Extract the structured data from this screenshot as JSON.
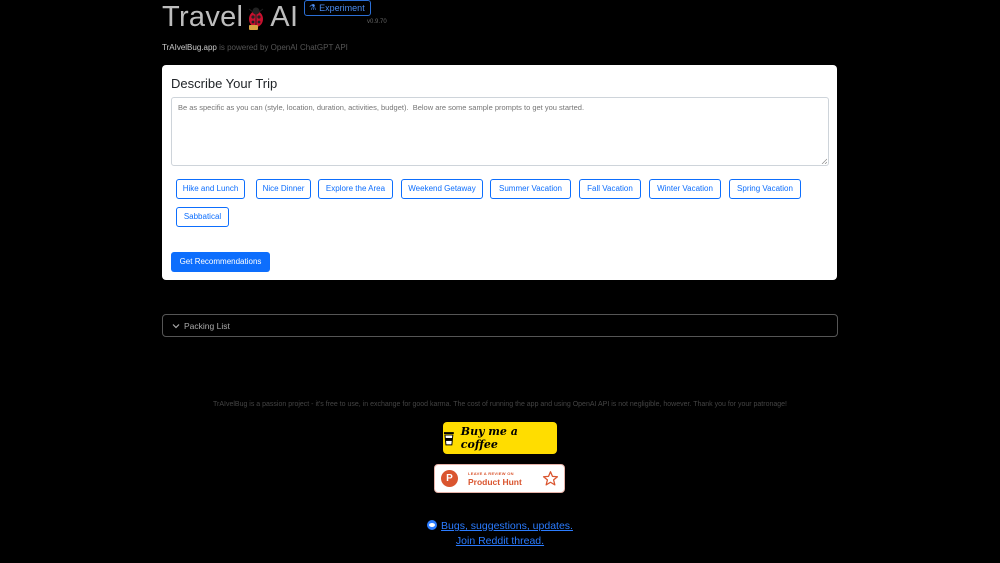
{
  "header": {
    "title_part1": "Travel",
    "title_part2": "AI",
    "logo_icon": "ladybug-icon",
    "badge_label": "Experiment",
    "badge_icon": "flask-icon",
    "version": "v0.9.70",
    "powered_site": "TrAIvelBug.app",
    "powered_text": " is powered by OpenAI ChatGPT API"
  },
  "card": {
    "title": "Describe Your Trip",
    "input_placeholder": "Be as specific as you can (style, location, duration, activities, budget).  Below are some sample prompts to get you started.",
    "input_value": "",
    "chips": [
      "Hike and Lunch",
      "Nice Dinner",
      "Explore the Area",
      "Weekend Getaway",
      "Summer Vacation",
      "Fall Vacation",
      "Winter Vacation",
      "Spring Vacation",
      "Sabbatical"
    ],
    "submit_label": "Get Recommendations"
  },
  "packing": {
    "label": "Packing List",
    "icon": "chevron-down-icon"
  },
  "footer": {
    "notice": "TrAIvelBug is a passion project - it's free to use, in exchange for good karma. The cost of running the app and using OpenAI API is not negligible, however. Thank you for your patronage!",
    "coffee_label": "Buy me a coffee",
    "ph_small": "LEAVE A REVIEW ON",
    "ph_big": "Product Hunt",
    "link1": "Bugs, suggestions, updates.",
    "link2": "Join Reddit thread."
  },
  "colors": {
    "accent": "#0d6efd",
    "background": "#000000",
    "coffee_yellow": "#ffdd00",
    "product_hunt": "#da552f"
  }
}
